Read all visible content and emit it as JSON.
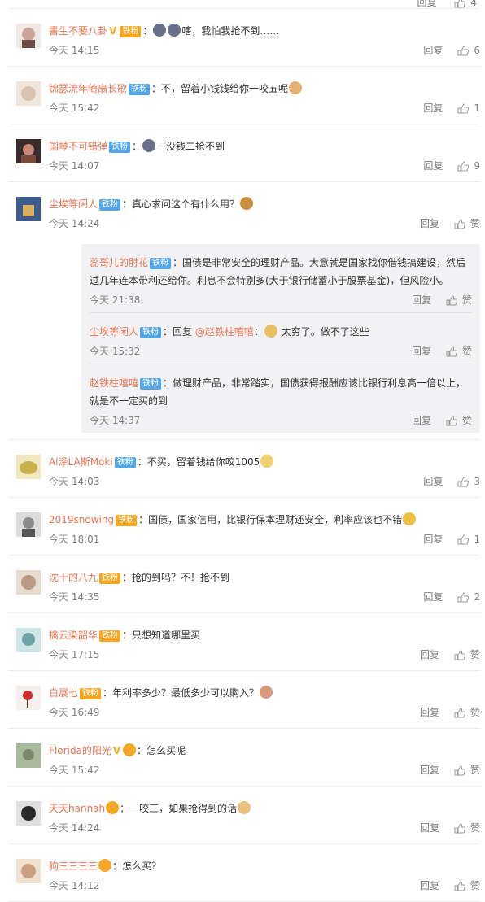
{
  "top_stub": {
    "reply": "回复",
    "likes": "4"
  },
  "comments": [
    {
      "user": "書生不要八卦",
      "verified": "V",
      "badge": "铁粉",
      "badge_type": "gold",
      "text": "嗐，我怕我抢不到……",
      "time": "今天 14:15",
      "reply": "回复",
      "likes": "6",
      "avatar_color": "#c8a49a",
      "emojis_before": 2
    },
    {
      "user": "锦瑟流年倚扇长歌",
      "badge": "铁粉",
      "badge_type": "fan",
      "text": "不，留着小钱钱给你一咬五呢",
      "time": "今天 15:42",
      "reply": "回复",
      "likes": "1",
      "avatar_color": "#d8c2b0",
      "emojis_after": 1
    },
    {
      "user": "国琴不可错弹",
      "badge": "铁粉",
      "badge_type": "fan",
      "text": "一没钱二抢不到",
      "time": "今天 14:07",
      "reply": "回复",
      "likes": "9",
      "avatar_color": "#7a4a3a",
      "emojis_before": 1
    },
    {
      "user": "尘埃等闲人",
      "badge": "铁粉",
      "badge_type": "fan",
      "text": "真心求问这个有什么用？",
      "time": "今天 14:24",
      "reply": "回复",
      "likes": "赞",
      "avatar_color": "#3b5c8c",
      "emojis_after": 1
    },
    {
      "user": "Al泽LA斯Moki",
      "badge": "铁粉",
      "badge_type": "fan",
      "text": "不买，留着钱给你咬1005",
      "time": "今天 14:03",
      "reply": "回复",
      "likes": "3",
      "avatar_color": "#c9b04a",
      "emojis_after": 1
    },
    {
      "user": "2019snowing",
      "badge": "铁粉",
      "badge_type": "gold",
      "text": "国债，国家信用，比银行保本理财还安全，利率应该也不错",
      "time": "今天 18:01",
      "reply": "回复",
      "likes": "1",
      "avatar_color": "#8a8a8a",
      "emojis_after": 1
    },
    {
      "user": "沈十的八九",
      "badge": "铁粉",
      "badge_type": "gold",
      "text": "抢的到吗？不！抢不到",
      "time": "今天 14:35",
      "reply": "回复",
      "likes": "2",
      "avatar_color": "#b89a86"
    },
    {
      "user": "擒云染韶华",
      "badge": "铁粉",
      "badge_type": "gold",
      "text": "只想知道哪里买",
      "time": "今天 17:15",
      "reply": "回复",
      "likes": "赞",
      "avatar_color": "#6fa3a8"
    },
    {
      "user": "白展七",
      "badge": "铁粉",
      "badge_type": "gold",
      "text": "年利率多少？最低多少可以购入？",
      "time": "今天 16:49",
      "reply": "回复",
      "likes": "赞",
      "avatar_color": "#e8e0dc",
      "emojis_after": 1
    },
    {
      "user": "Florida的阳光",
      "verified": "V",
      "badge": "",
      "badge_type": "gold",
      "text": "怎么买呢",
      "time": "今天 15:42",
      "reply": "回复",
      "likes": "赞",
      "avatar_color": "#7a8a6a"
    },
    {
      "user": "天天hannah",
      "badge": "",
      "badge_type": "gold",
      "text": "一咬三，如果抢得到的话",
      "time": "今天 14:24",
      "reply": "回复",
      "likes": "赞",
      "avatar_color": "#2a2a2a",
      "emojis_after": 1
    },
    {
      "user": "狗三三三三",
      "badge": "",
      "badge_type": "gold",
      "text": "怎么买？",
      "time": "今天 14:12",
      "reply": "回复",
      "likes": "赞",
      "avatar_color": "#c9a080"
    }
  ],
  "sub_replies": [
    {
      "user": "蕊哥儿的肘花",
      "badge": "铁粉",
      "text": "国债是非常安全的理财产品。大意就是国家找你借钱搞建设，然后过几年连本带利还给你。利息不会特别多(大于银行储蓄小于股票基金)，但风险小。",
      "time": "今天 21:38",
      "reply": "回复",
      "likes": "赞"
    },
    {
      "user": "尘埃等闲人",
      "badge": "铁粉",
      "reply_prefix": "回复",
      "at": "@赵铁柱嘻嘻",
      "text": "太穷了。做不了这些",
      "time": "今天 15:32",
      "reply": "回复",
      "likes": "赞"
    },
    {
      "user": "赵铁柱嘻嘻",
      "badge": "铁粉",
      "text": "做理财产品，非常踏实，国债获得报酬应该比银行利息高一倍以上，就是不一定买的到",
      "time": "今天 14:37",
      "reply": "回复",
      "likes": "赞"
    }
  ],
  "colors": {
    "username": "#eb7350",
    "fan_badge": "#54a7e7",
    "gold_badge": "#f5a623",
    "meta": "#808080",
    "reply_bg": "#f2f2f5"
  }
}
